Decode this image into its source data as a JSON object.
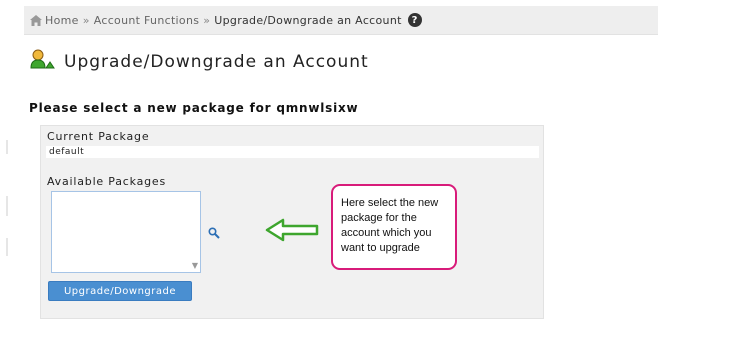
{
  "breadcrumb": {
    "home": "Home",
    "separator": "»",
    "section": "Account Functions",
    "current": "Upgrade/Downgrade an Account",
    "help_symbol": "?"
  },
  "page": {
    "title": "Upgrade/Downgrade an Account",
    "subtitle": "Please select a new package for qmnwlsixw"
  },
  "form": {
    "current_package_label": "Current Package",
    "current_package_value": "default",
    "available_packages_label": "Available Packages",
    "available_packages_options": [],
    "submit_label": "Upgrade/Downgrade"
  },
  "annotation": {
    "callout_text": "Here select the new package for the account which you want to upgrade",
    "callout_border_color": "#d81b7a",
    "arrow_color": "#3ea62e"
  },
  "colors": {
    "button": "#4a8fd1",
    "panel": "#f1f1f1",
    "breadcrumb_bar": "#eeeeee"
  }
}
